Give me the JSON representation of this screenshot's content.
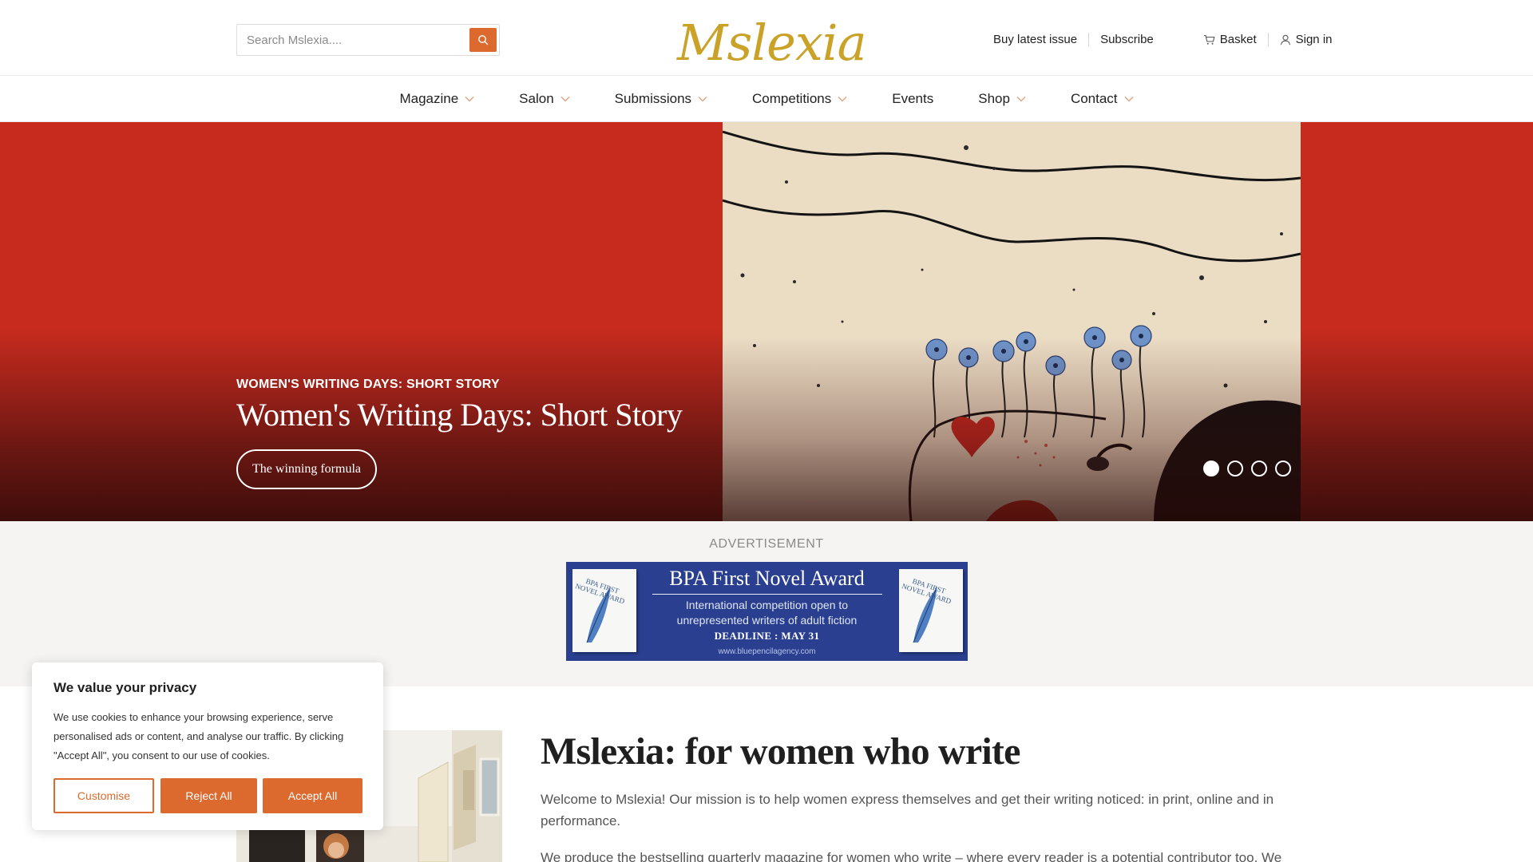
{
  "header": {
    "search": {
      "placeholder": "Search Mslexia...."
    },
    "logo_text": "Mslexia",
    "top_links": {
      "buy_latest_issue": "Buy latest issue",
      "subscribe": "Subscribe",
      "basket": "Basket",
      "sign_in": "Sign in"
    },
    "icons": {
      "search": "search-icon",
      "basket": "basket-icon",
      "user": "user-icon",
      "chevron": "chevron-down-icon"
    }
  },
  "nav": {
    "items": [
      {
        "label": "Magazine",
        "has_dropdown": true
      },
      {
        "label": "Salon",
        "has_dropdown": true
      },
      {
        "label": "Submissions",
        "has_dropdown": true
      },
      {
        "label": "Competitions",
        "has_dropdown": true
      },
      {
        "label": "Events",
        "has_dropdown": false
      },
      {
        "label": "Shop",
        "has_dropdown": true
      },
      {
        "label": "Contact",
        "has_dropdown": true
      }
    ]
  },
  "hero": {
    "kicker": "WOMEN'S WRITING DAYS: SHORT STORY",
    "title": "Women's Writing Days: Short Story",
    "button": "The winning formula",
    "slide_count": 4,
    "active_slide": 1,
    "background_color": "#c62b1d"
  },
  "advertisement": {
    "label": "ADVERTISEMENT",
    "title": "BPA First Novel Award",
    "subtitle_line1": "International competition open to",
    "subtitle_line2": "unrepresented writers of adult fiction",
    "deadline": "DEADLINE : MAY 31",
    "url": "www.bluepencilagency.com",
    "book_text": "BPA FIRST NOVEL AWARD",
    "background_color": "#2a3f8f"
  },
  "intro": {
    "title": "Mslexia: for women who write",
    "paragraph1": "Welcome to Mslexia! Our mission is to help women express themselves and get their writing noticed: in print, online and in performance.",
    "paragraph2": "We produce the bestselling quarterly magazine for women who write – where every reader is a potential contributor too. We"
  },
  "cookie_banner": {
    "title": "We value your privacy",
    "text": "We use cookies to enhance your browsing experience, serve personalised ads or content, and analyse our traffic. By clicking \"Accept All\", you consent to our use of cookies.",
    "customise": "Customise",
    "reject_all": "Reject All",
    "accept_all": "Accept All",
    "accent_color": "#dc6a2f"
  }
}
